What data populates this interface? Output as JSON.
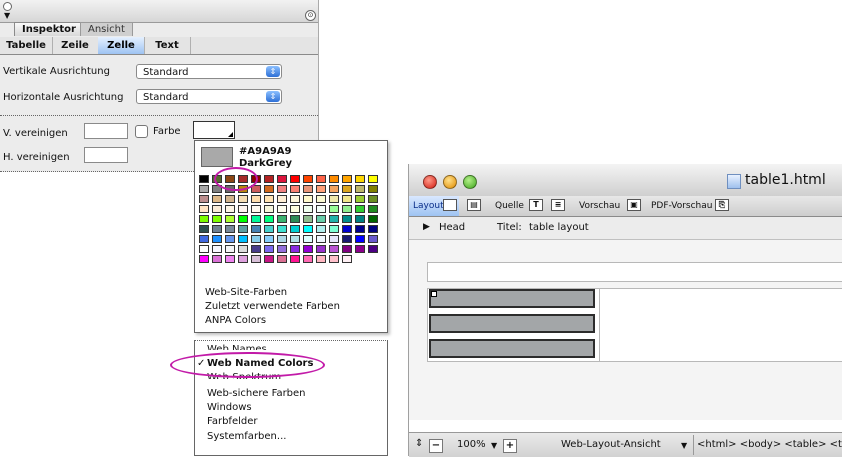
{
  "inspector": {
    "tabs": [
      "Inspektor",
      "Ansicht"
    ],
    "subtabs": [
      "Tabelle",
      "Zeile",
      "Zelle",
      "Text"
    ],
    "active_subtab": "Zelle",
    "vertical_label": "Vertikale Ausrichtung",
    "vertical_value": "Standard",
    "horizontal_label": "Horizontale Ausrichtung",
    "horizontal_value": "Standard",
    "v_merge_label": "V. vereinigen",
    "h_merge_label": "H. vereinigen",
    "color_label": "Farbe"
  },
  "color_menu": {
    "selected_hex": "#A9A9A9",
    "selected_name": "DarkGrey",
    "palette": [
      "#000000",
      "#556B2F",
      "#8B4513",
      "#A52A2A",
      "#8B0000",
      "#B22222",
      "#DC143C",
      "#FF0000",
      "#FF4500",
      "#FF6347",
      "#FF8C00",
      "#FFA500",
      "#FFD700",
      "#FFFF00",
      "#A9A9A9",
      "#808080",
      "#696969",
      "#B8860B",
      "#CD5C5C",
      "#D2691E",
      "#F08080",
      "#FA8072",
      "#E9967A",
      "#FFA07A",
      "#F4A460",
      "#DAA520",
      "#BDB76B",
      "#808000",
      "#BC8F8F",
      "#DEB887",
      "#D2B48C",
      "#F5DEB3",
      "#FFDEAD",
      "#FFE4B5",
      "#FFEFD5",
      "#FFF8DC",
      "#FFFACD",
      "#FAFAD2",
      "#EEE8AA",
      "#F0E68C",
      "#9ACD32",
      "#6B8E23",
      "#FFE4C4",
      "#FAEBD7",
      "#FDF5E6",
      "#FFF5EE",
      "#FFFAF0",
      "#F5F5DC",
      "#FFFFF0",
      "#FFFFE0",
      "#F0FFF0",
      "#F5FFFA",
      "#98FB98",
      "#90EE90",
      "#32CD32",
      "#228B22",
      "#7CFC00",
      "#7FFF00",
      "#ADFF2F",
      "#00FF00",
      "#00FA9A",
      "#00FF7F",
      "#3CB371",
      "#2E8B57",
      "#8FBC8F",
      "#66CDAA",
      "#20B2AA",
      "#008B8B",
      "#008080",
      "#006400",
      "#2F4F4F",
      "#708090",
      "#778899",
      "#5F9EA0",
      "#4682B4",
      "#48D1CC",
      "#40E0D0",
      "#00CED1",
      "#00FFFF",
      "#AFEEEE",
      "#7FFFD4",
      "#0000CD",
      "#00008B",
      "#000080",
      "#4169E1",
      "#1E90FF",
      "#6495ED",
      "#00BFFF",
      "#87CEEB",
      "#87CEFA",
      "#ADD8E6",
      "#B0E0E6",
      "#E0FFFF",
      "#F0F8FF",
      "#E6E6FA",
      "#191970",
      "#0000FF",
      "#6A5ACD",
      "#FFFFFF",
      "#F8F8FF",
      "#F5F5F5",
      "#DCDCDC",
      "#483D8B",
      "#7B68EE",
      "#9370DB",
      "#8A2BE2",
      "#9400D3",
      "#9932CC",
      "#BA55D3",
      "#800080",
      "#8B008B",
      "#4B0082",
      "#FF00FF",
      "#DA70D6",
      "#EE82EE",
      "#DDA0DD",
      "#D8BFD8",
      "#C71585",
      "#DB7093",
      "#FF1493",
      "#FF69B4",
      "#FFB6C1",
      "#FFC0CB",
      "#FFF0F5"
    ],
    "options": [
      "Web-Site-Farben",
      "Zuletzt verwendete Farben",
      "ANPA Colors"
    ],
    "schemes_partial": "Web Names",
    "schemes": [
      "Web Named Colors",
      "Web-Spektrum",
      "Web-sichere Farben",
      "Windows",
      "Farbfelder",
      "Systemfarben..."
    ],
    "checked_scheme": "Web Named Colors",
    "checkmark": "✓"
  },
  "document": {
    "title": "table1.html",
    "toolbar": {
      "layout": "Layout",
      "quelle": "Quelle",
      "vorschau": "Vorschau",
      "pdf": "PDF-Vorschau"
    },
    "head_label": "Head",
    "title_label": "Titel:",
    "title_value": "table layout",
    "status": {
      "zoom": "100%",
      "view": "Web-Layout-Ansicht",
      "tags": "<html> <body> <table> <tr>"
    }
  },
  "colors": {
    "highlight_ring": "#c21aa8",
    "selected_tab": "#9ec3f2",
    "cell_fill": "#a3a6a8"
  }
}
